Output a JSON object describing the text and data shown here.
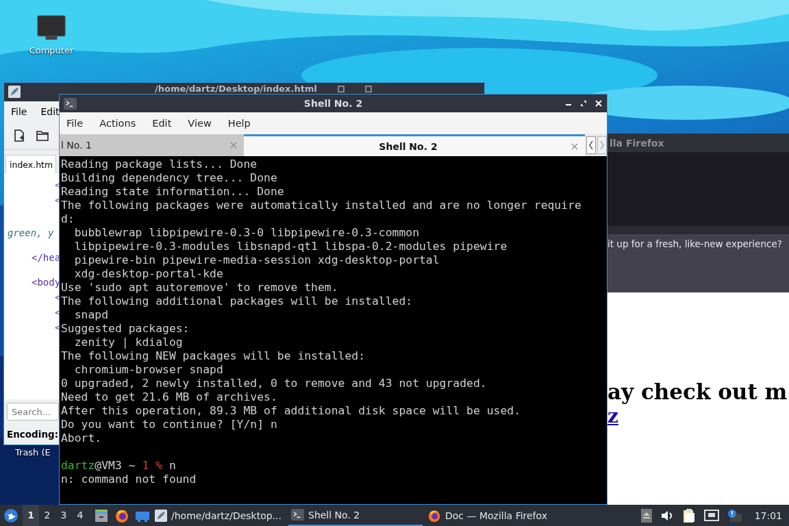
{
  "desktop": {
    "icons": [
      {
        "label": "Computer",
        "kind": "computer"
      },
      {
        "label": "Trash (E",
        "kind": "trash"
      }
    ]
  },
  "editor_window": {
    "title": "/home/dartz/Desktop/index.html",
    "menu": [
      "File",
      "Edit"
    ],
    "tab": "index.htm",
    "code_lines": [
      {
        "text": "<",
        "kind": "tag-deep"
      },
      {
        "text": "<",
        "kind": "tag-deep"
      },
      {
        "text": "green, y",
        "kind": "comment"
      },
      {
        "text": "</hea",
        "kind": "tag"
      },
      {
        "text": "<body",
        "kind": "tag"
      },
      {
        "text": "<",
        "kind": "tag-deep"
      },
      {
        "text": "<",
        "kind": "tag-deep"
      },
      {
        "text": "<",
        "kind": "tag-deep"
      }
    ],
    "search": {
      "placeholder": "Search..."
    },
    "encoding_label": "Encoding:"
  },
  "firefox_window": {
    "title": "lla Firefox",
    "notification": "it up for a fresh, like-new experience?",
    "heading": "ay check out m",
    "link": "z"
  },
  "terminal_window": {
    "title": "Shell No. 2",
    "menu": [
      "File",
      "Actions",
      "Edit",
      "View",
      "Help"
    ],
    "tabs": [
      {
        "label": "l No. 1",
        "selected": false
      },
      {
        "label": "Shell No. 2",
        "selected": true
      }
    ],
    "lines": [
      {
        "kind": "output",
        "text": "Reading package lists... Done"
      },
      {
        "kind": "output",
        "text": "Building dependency tree... Done"
      },
      {
        "kind": "output",
        "text": "Reading state information... Done"
      },
      {
        "kind": "output",
        "text": "The following packages were automatically installed and are no longer require"
      },
      {
        "kind": "output",
        "text": "d:"
      },
      {
        "kind": "output",
        "text": "  bubblewrap libpipewire-0.3-0 libpipewire-0.3-common"
      },
      {
        "kind": "output",
        "text": "  libpipewire-0.3-modules libsnapd-qt1 libspa-0.2-modules pipewire"
      },
      {
        "kind": "output",
        "text": "  pipewire-bin pipewire-media-session xdg-desktop-portal"
      },
      {
        "kind": "output",
        "text": "  xdg-desktop-portal-kde"
      },
      {
        "kind": "output",
        "text": "Use 'sudo apt autoremove' to remove them."
      },
      {
        "kind": "output",
        "text": "The following additional packages will be installed:"
      },
      {
        "kind": "output",
        "text": "  snapd"
      },
      {
        "kind": "output",
        "text": "Suggested packages:"
      },
      {
        "kind": "output",
        "text": "  zenity | kdialog"
      },
      {
        "kind": "output",
        "text": "The following NEW packages will be installed:"
      },
      {
        "kind": "output",
        "text": "  chromium-browser snapd"
      },
      {
        "kind": "output",
        "text": "0 upgraded, 2 newly installed, 0 to remove and 43 not upgraded."
      },
      {
        "kind": "output",
        "text": "Need to get 21.6 MB of archives."
      },
      {
        "kind": "output",
        "text": "After this operation, 89.3 MB of additional disk space will be used."
      },
      {
        "kind": "output",
        "text": "Do you want to continue? [Y/n] n"
      },
      {
        "kind": "output",
        "text": "Abort."
      },
      {
        "kind": "blank"
      },
      {
        "kind": "prompt",
        "user": "dartz",
        "host": "@VM3 ~ ",
        "status": "1 %",
        "command": " n"
      },
      {
        "kind": "output",
        "text": "n: command not found"
      }
    ]
  },
  "taskbar": {
    "desktops": [
      {
        "label": "1",
        "selected": true
      },
      {
        "label": "2",
        "selected": false
      },
      {
        "label": "3",
        "selected": false
      },
      {
        "label": "4",
        "selected": false
      }
    ],
    "tasks": [
      {
        "label": "/home/dartz/Desktop...",
        "kind": "editor",
        "selected": false
      },
      {
        "label": "Shell No. 2",
        "kind": "terminal",
        "selected": true
      },
      {
        "label": "Doc — Mozilla Firefox",
        "kind": "firefox",
        "selected": false
      }
    ],
    "clock": "17:01"
  }
}
